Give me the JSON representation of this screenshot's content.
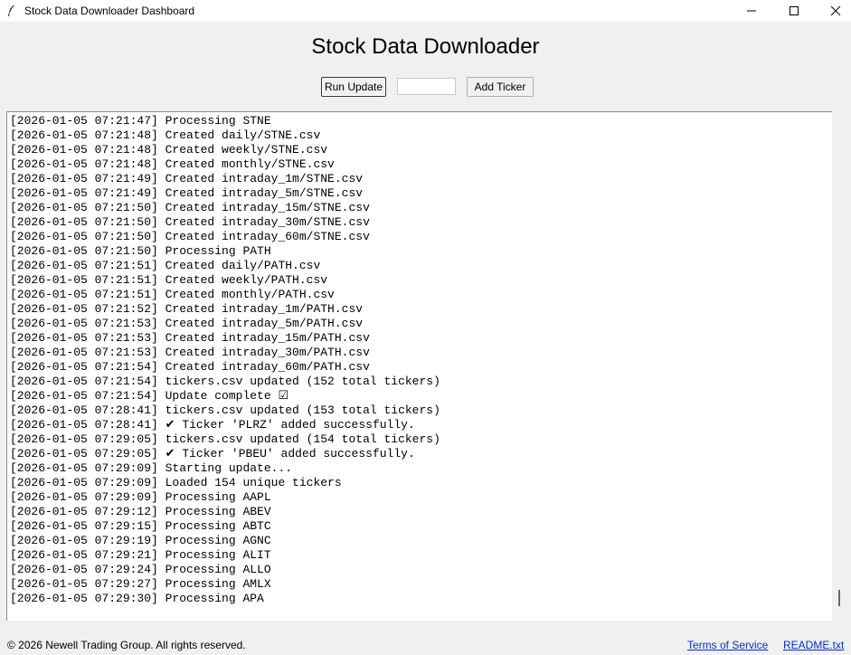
{
  "window": {
    "title": "Stock Data Downloader Dashboard",
    "controls": [
      "minimize-icon",
      "maximize-icon",
      "close-icon"
    ]
  },
  "header": {
    "title": "Stock Data Downloader"
  },
  "toolbar": {
    "run_label": "Run Update",
    "ticker_value": "",
    "add_label": "Add Ticker"
  },
  "log": [
    "[2026-01-05 07:21:47] Processing STNE",
    "[2026-01-05 07:21:48] Created daily/STNE.csv",
    "[2026-01-05 07:21:48] Created weekly/STNE.csv",
    "[2026-01-05 07:21:48] Created monthly/STNE.csv",
    "[2026-01-05 07:21:49] Created intraday_1m/STNE.csv",
    "[2026-01-05 07:21:49] Created intraday_5m/STNE.csv",
    "[2026-01-05 07:21:50] Created intraday_15m/STNE.csv",
    "[2026-01-05 07:21:50] Created intraday_30m/STNE.csv",
    "[2026-01-05 07:21:50] Created intraday_60m/STNE.csv",
    "[2026-01-05 07:21:50] Processing PATH",
    "[2026-01-05 07:21:51] Created daily/PATH.csv",
    "[2026-01-05 07:21:51] Created weekly/PATH.csv",
    "[2026-01-05 07:21:51] Created monthly/PATH.csv",
    "[2026-01-05 07:21:52] Created intraday_1m/PATH.csv",
    "[2026-01-05 07:21:53] Created intraday_5m/PATH.csv",
    "[2026-01-05 07:21:53] Created intraday_15m/PATH.csv",
    "[2026-01-05 07:21:53] Created intraday_30m/PATH.csv",
    "[2026-01-05 07:21:54] Created intraday_60m/PATH.csv",
    "[2026-01-05 07:21:54] tickers.csv updated (152 total tickers)",
    "[2026-01-05 07:21:54] Update complete ☑",
    "[2026-01-05 07:28:41] tickers.csv updated (153 total tickers)",
    "[2026-01-05 07:28:41] ✔ Ticker 'PLRZ' added successfully.",
    "[2026-01-05 07:29:05] tickers.csv updated (154 total tickers)",
    "[2026-01-05 07:29:05] ✔ Ticker 'PBEU' added successfully.",
    "[2026-01-05 07:29:09] Starting update...",
    "[2026-01-05 07:29:09] Loaded 154 unique tickers",
    "[2026-01-05 07:29:09] Processing AAPL",
    "[2026-01-05 07:29:12] Processing ABEV",
    "[2026-01-05 07:29:15] Processing ABTC",
    "[2026-01-05 07:29:19] Processing AGNC",
    "[2026-01-05 07:29:21] Processing ALIT",
    "[2026-01-05 07:29:24] Processing ALLO",
    "[2026-01-05 07:29:27] Processing AMLX",
    "[2026-01-05 07:29:30] Processing APA"
  ],
  "footer": {
    "copyright": "© 2026 Newell Trading Group. All rights reserved.",
    "terms_label": "Terms of Service",
    "readme_label": "README.txt"
  }
}
